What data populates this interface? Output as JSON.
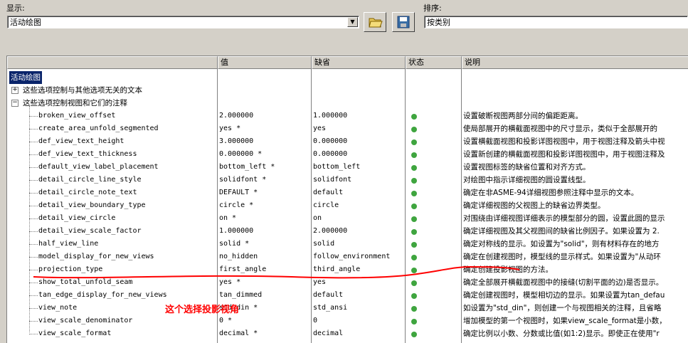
{
  "toolbar": {
    "display_label": "显示:",
    "display_value": "活动绘图",
    "sort_label": "排序:",
    "sort_value": "按类别"
  },
  "grid": {
    "columns": [
      "值",
      "缺省",
      "状态",
      "说明"
    ],
    "root": "活动绘图",
    "groups": [
      "这些选项控制与其他选项无关的文本",
      "这些选项控制视图和它们的注释"
    ],
    "rows": [
      {
        "name": "broken_view_offset",
        "value": "2.000000",
        "default": "1.000000",
        "desc": "设置破断视图两部分间的偏距距离。"
      },
      {
        "name": "create_area_unfold_segmented",
        "value": "yes *",
        "default": "yes",
        "desc": "使局部展开的横截面视图中的尺寸显示，类似于全部展开的"
      },
      {
        "name": "def_view_text_height",
        "value": "3.000000",
        "default": "0.000000",
        "desc": "设置横截面视图和投影详图视图中，用于视图注释及箭头中视"
      },
      {
        "name": "def_view_text_thickness",
        "value": "0.000000 *",
        "default": "0.000000",
        "desc": "设置新创建的横截面视图和投影详图视图中，用于视图注释及"
      },
      {
        "name": "default_view_label_placement",
        "value": "bottom_left *",
        "default": "bottom_left",
        "desc": "设置视图标签的缺省位置和对齐方式。"
      },
      {
        "name": "detail_circle_line_style",
        "value": "solidfont *",
        "default": "solidfont",
        "desc": "对绘图中指示详细视图的圆设置线型。"
      },
      {
        "name": "detail_circle_note_text",
        "value": "DEFAULT *",
        "default": "default",
        "desc": "确定在非ASME-94详细视图参照注释中显示的文本。"
      },
      {
        "name": "detail_view_boundary_type",
        "value": "circle *",
        "default": "circle",
        "desc": "确定详细视图的父视图上的缺省边界类型。"
      },
      {
        "name": "detail_view_circle",
        "value": "on *",
        "default": "on",
        "desc": "对围绕由详细视图详细表示的模型部分的圆，设置此圆的显示"
      },
      {
        "name": "detail_view_scale_factor",
        "value": "1.000000",
        "default": "2.000000",
        "desc": "确定详细视图及其父视图间的缺省比例因子。如果设置为 2."
      },
      {
        "name": "half_view_line",
        "value": "solid *",
        "default": "solid",
        "desc": "确定对称线的显示。如设置为\"solid\"，则有材料存在的地方"
      },
      {
        "name": "model_display_for_new_views",
        "value": "no_hidden",
        "default": "follow_environment",
        "desc": "确定在创建视图时，模型线的显示样式。如果设置为\"从动环"
      },
      {
        "name": "projection_type",
        "value": "first_angle",
        "default": "third_angle",
        "desc": "确定创建投影视图的方法。"
      },
      {
        "name": "show_total_unfold_seam",
        "value": "yes *",
        "default": "yes",
        "desc": "确定全部展开横截面视图中的接缝(切割平面的边)是否显示。"
      },
      {
        "name": "tan_edge_display_for_new_views",
        "value": "tan_dimmed",
        "default": "default",
        "desc": "确定创建视图时，模型相切边的显示。如果设置为tan_defau"
      },
      {
        "name": "view_note",
        "value": "std_din *",
        "default": "std_ansi",
        "desc": "如设置为\"std_din\"，则创建一个与视图相关的注释，且省略"
      },
      {
        "name": "view_scale_denominator",
        "value": "0 *",
        "default": "0",
        "desc": "增加模型的第一个视图时，如果view_scale_format是小数，"
      },
      {
        "name": "view_scale_format",
        "value": "decimal *",
        "default": "decimal",
        "desc": "确定比例以小数、分数或比值(如1:2)显示。即使正在使用\"r"
      }
    ]
  },
  "annotation": {
    "text": "这个选择投影视角",
    "color": "#ff0000"
  },
  "colors": {
    "status_ok": "#3fa53f",
    "selection": "#0a246a"
  }
}
